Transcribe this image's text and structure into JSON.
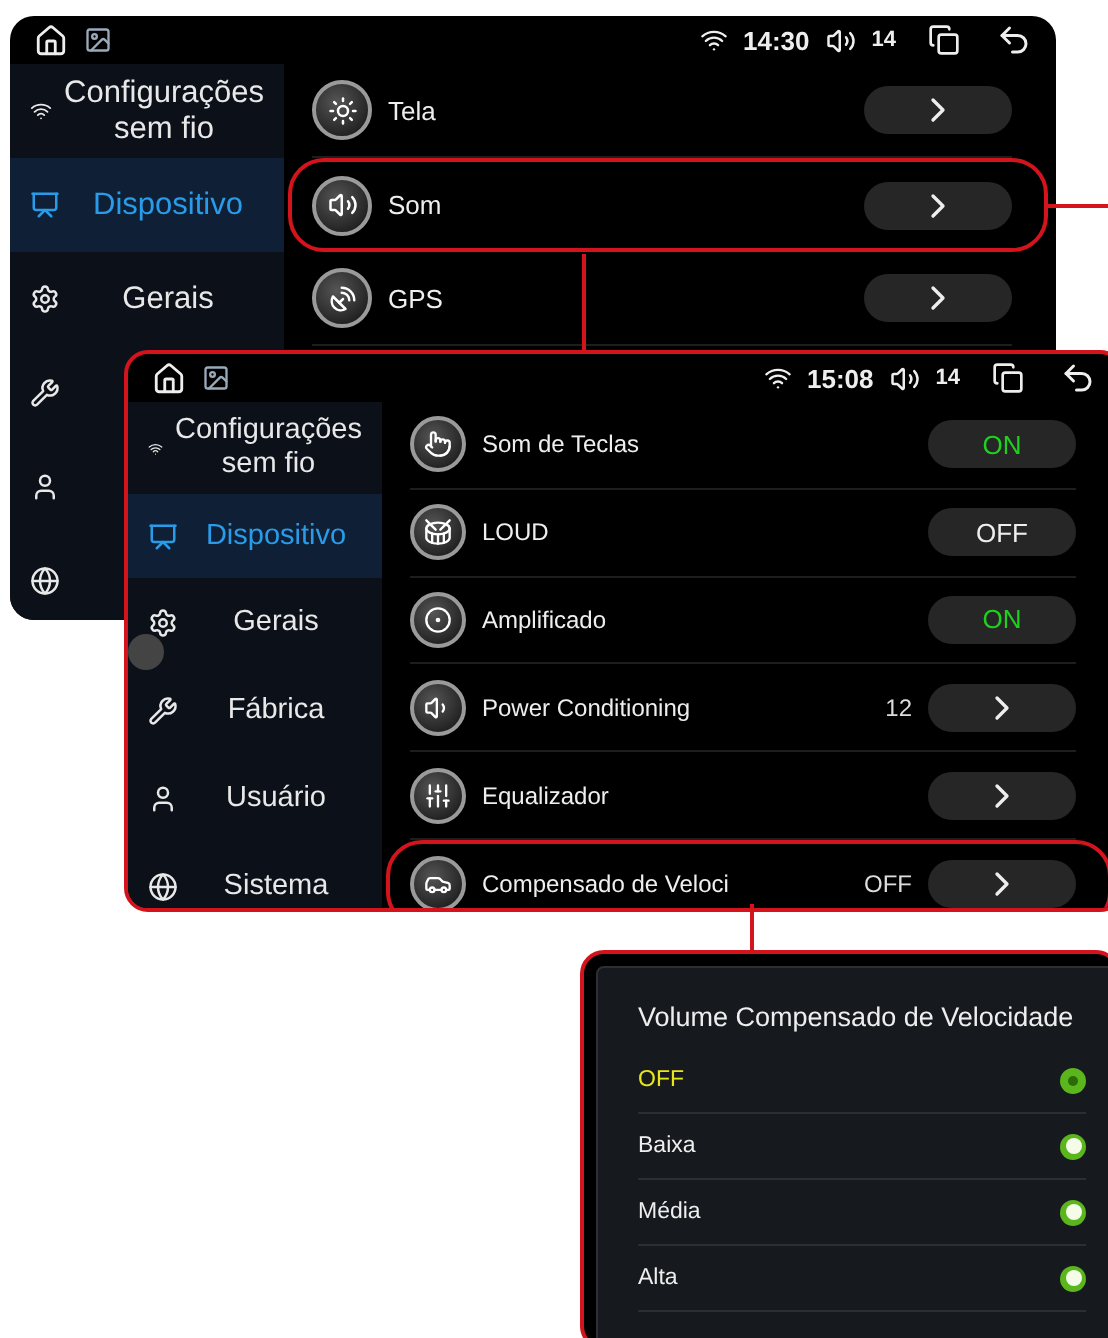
{
  "screens": [
    {
      "status": {
        "time": "14:30",
        "volume": "14"
      },
      "sidebar": [
        {
          "label": "Configurações sem fio",
          "selected": false
        },
        {
          "label": "Dispositivo",
          "selected": true
        },
        {
          "label": "Gerais",
          "selected": false
        }
      ],
      "rows": [
        {
          "label": "Tela",
          "kind": "link",
          "highlighted": false
        },
        {
          "label": "Som",
          "kind": "link",
          "highlighted": true
        },
        {
          "label": "GPS",
          "kind": "link",
          "highlighted": false
        }
      ]
    },
    {
      "status": {
        "time": "15:08",
        "volume": "14"
      },
      "sidebar": [
        {
          "label": "Configurações sem fio",
          "selected": false
        },
        {
          "label": "Dispositivo",
          "selected": true
        },
        {
          "label": "Gerais",
          "selected": false
        },
        {
          "label": "Fábrica",
          "selected": false
        },
        {
          "label": "Usuário",
          "selected": false
        },
        {
          "label": "Sistema",
          "selected": false
        }
      ],
      "rows": [
        {
          "label": "Som de Teclas",
          "kind": "toggle",
          "on": true,
          "value": "ON",
          "highlighted": false
        },
        {
          "label": "LOUD",
          "kind": "toggle",
          "on": false,
          "value": "OFF",
          "highlighted": false
        },
        {
          "label": "Amplificado",
          "kind": "toggle",
          "on": true,
          "value": "ON",
          "highlighted": false
        },
        {
          "label": "Power Conditioning",
          "kind": "link",
          "value": "12",
          "highlighted": false
        },
        {
          "label": "Equalizador",
          "kind": "link",
          "highlighted": false
        },
        {
          "label": "Compensado de Veloci",
          "kind": "link",
          "value": "OFF",
          "highlighted": true
        }
      ]
    }
  ],
  "dialog": {
    "title": "Volume Compensado de Velocidade",
    "options": [
      {
        "label": "OFF",
        "selected": true
      },
      {
        "label": "Baixa",
        "selected": false
      },
      {
        "label": "Média",
        "selected": false
      },
      {
        "label": "Alta",
        "selected": false
      }
    ]
  }
}
